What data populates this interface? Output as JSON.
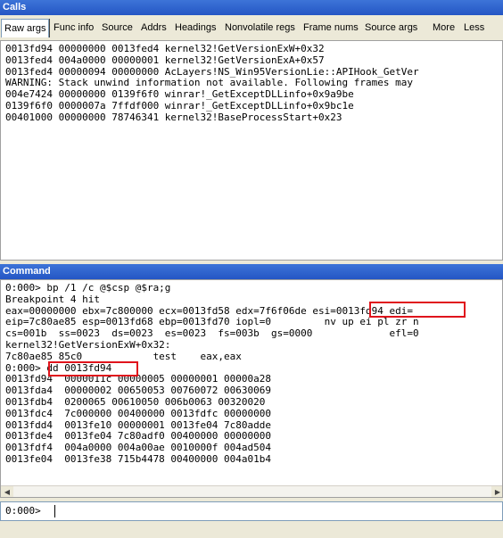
{
  "calls": {
    "title": "Calls",
    "tabs": [
      "Raw args",
      "Func info",
      "Source",
      "Addrs",
      "Headings",
      "Nonvolatile regs",
      "Frame nums",
      "Source args",
      "More",
      "Less"
    ],
    "lines": [
      "0013fd94 00000000 0013fed4 kernel32!GetVersionExW+0x32",
      "0013fed4 004a0000 00000001 kernel32!GetVersionExA+0x57",
      "0013fed4 00000094 00000000 AcLayers!NS_Win95VersionLie::APIHook_GetVer",
      "WARNING: Stack unwind information not available. Following frames may",
      "004e7424 00000000 0139f6f0 winrar!_GetExceptDLLinfo+0x9a9be",
      "0139f6f0 0000007a 7ffdf000 winrar!_GetExceptDLLinfo+0x9bc1e",
      "00401000 00000000 78746341 kernel32!BaseProcessStart+0x23"
    ]
  },
  "command": {
    "title": "Command",
    "lines": [
      "0:000> bp /1 /c @$csp @$ra;g",
      "Breakpoint 4 hit",
      "eax=00000000 ebx=7c800000 ecx=0013fd58 edx=7f6f06de esi=0013fd94 edi=",
      "eip=7c80ae85 esp=0013fd68 ebp=0013fd70 iopl=0         nv up ei pl zr n",
      "cs=001b  ss=0023  ds=0023  es=0023  fs=003b  gs=0000             efl=0",
      "kernel32!GetVersionExW+0x32:",
      "7c80ae85 85c0            test    eax,eax",
      "0:000> dd 0013fd94",
      "0013fd94  0000011c 00000005 00000001 00000a28",
      "0013fda4  00000002 00650053 00760072 00630069",
      "0013fdb4  0200065 00610050 006b0063 00320020",
      "0013fdc4  7c000000 00400000 0013fdfc 00000000",
      "0013fdd4  0013fe10 00000001 0013fe04 7c80adde",
      "0013fde4  0013fe04 7c80adf0 00400000 00000000",
      "0013fdf4  004a0000 004a00ae 0010000f 004ad504",
      "0013fe04  0013fe38 715b4478 00400000 004a01b4"
    ]
  },
  "input": {
    "prompt": "0:000>",
    "value": ""
  }
}
